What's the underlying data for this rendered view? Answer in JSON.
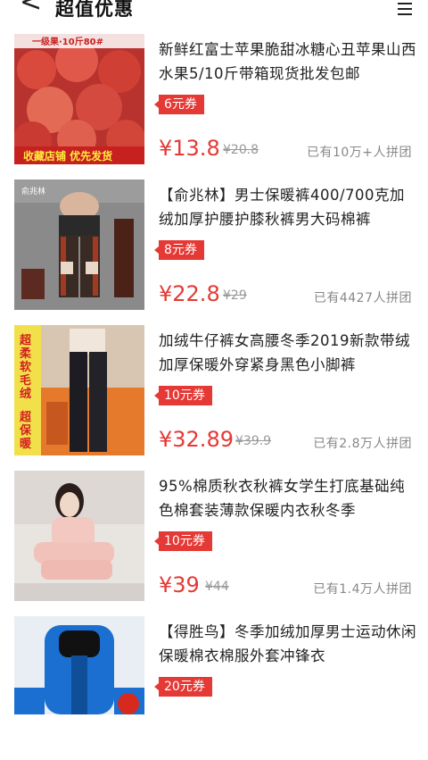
{
  "header": {
    "back_glyph": "<",
    "title": "超值优惠",
    "menu_icon": "menu-icon"
  },
  "colors": {
    "accent": "#e53935",
    "muted": "#999999"
  },
  "items": [
    {
      "title": "新鲜红富士苹果脆甜冰糖心丑苹果山西水果5/10斤带箱现货批发包邮",
      "coupon": "6元券",
      "price": "¥13.8",
      "old_price": "¥20.8",
      "sold": "已有10万+人拼团",
      "image_text_top": "一级果·10斤80#",
      "image_text_bottom": "收藏店铺 优先发货"
    },
    {
      "title": "【俞兆林】男士保暖裤400/700克加绒加厚护腰护膝秋裤男大码棉裤",
      "coupon": "8元券",
      "price": "¥22.8",
      "old_price": "¥29",
      "sold": "已有4427人拼团",
      "image_text_top": "俞兆林"
    },
    {
      "title": "加绒牛仔裤女高腰冬季2019新款带绒加厚保暖外穿紧身黑色小脚裤",
      "coupon": "10元券",
      "price": "¥32.89",
      "old_price": "¥39.9",
      "sold": "已有2.8万人拼团",
      "image_text_top": "超柔软毛绒",
      "image_text_bottom": "超保暖"
    },
    {
      "title": "95%棉质秋衣秋裤女学生打底基础纯色棉套装薄款保暖内衣秋冬季",
      "coupon": "10元券",
      "price": "¥39",
      "old_price": "¥44",
      "sold": "已有1.4万人拼团"
    },
    {
      "title": "【得胜鸟】冬季加绒加厚男士运动休闲保暖棉衣棉服外套冲锋衣",
      "coupon": "20元券",
      "price": "",
      "old_price": "",
      "sold": ""
    }
  ]
}
